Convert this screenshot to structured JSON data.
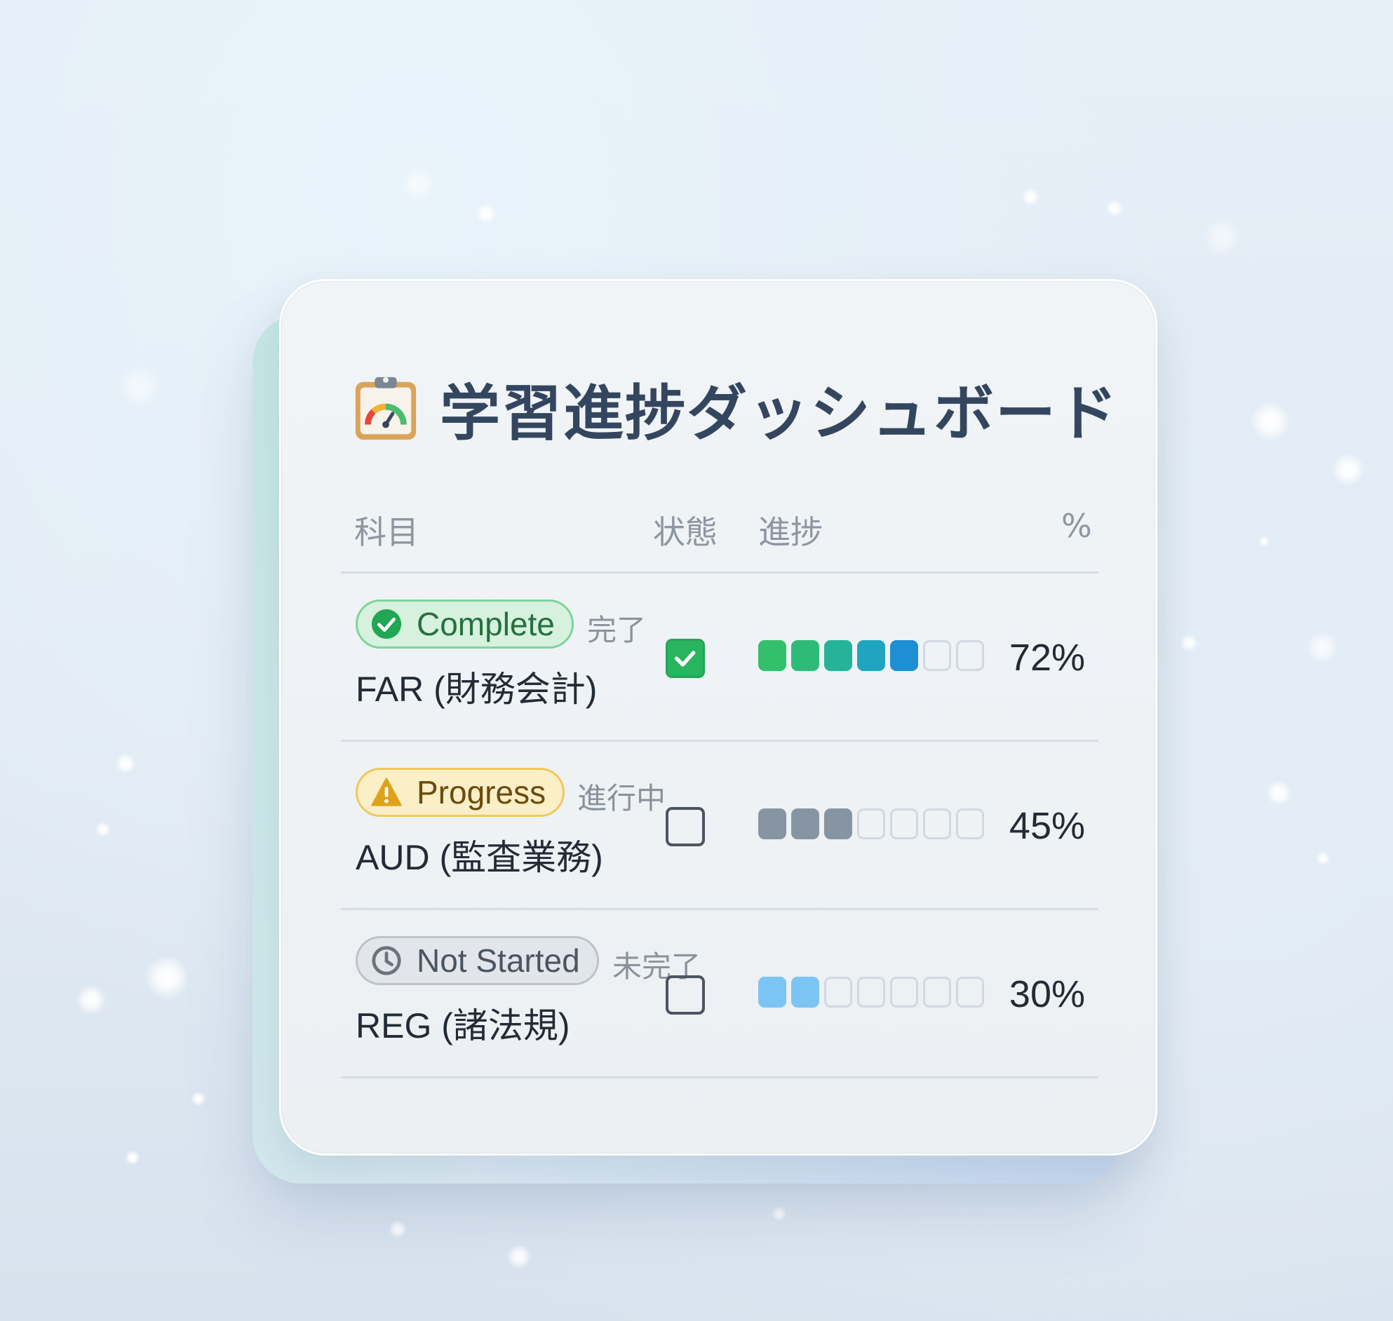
{
  "dashboard": {
    "title": "学習進捗ダッシュボード",
    "title_icon": "clipboard-gauge-icon",
    "columns": {
      "subject": "科目",
      "status": "状態",
      "progress": "進捗",
      "percent": "%"
    },
    "rows": [
      {
        "badge_label": "Complete",
        "badge_icon": "check-circle-icon",
        "status_jp": "完了",
        "subject": "FAR (財務会計)",
        "checked": true,
        "progress_filled": 5,
        "progress_total": 7,
        "percent": "72%",
        "segment_colors": [
          "#33c06a",
          "#2ebb78",
          "#25b39a",
          "#1fa5bf",
          "#1f8fd4"
        ]
      },
      {
        "badge_label": "Progress",
        "badge_icon": "warning-triangle-icon",
        "status_jp": "進行中",
        "subject": "AUD (監査業務)",
        "checked": false,
        "progress_filled": 3,
        "progress_total": 7,
        "percent": "45%",
        "segment_colors": [
          "#8795a3",
          "#8795a3",
          "#8795a3"
        ]
      },
      {
        "badge_label": "Not Started",
        "badge_icon": "clock-icon",
        "status_jp": "未完了",
        "subject": "REG (諸法規)",
        "checked": false,
        "progress_filled": 2,
        "progress_total": 7,
        "percent": "30%",
        "segment_colors": [
          "#7cc4f4",
          "#7cc4f4"
        ]
      }
    ]
  }
}
